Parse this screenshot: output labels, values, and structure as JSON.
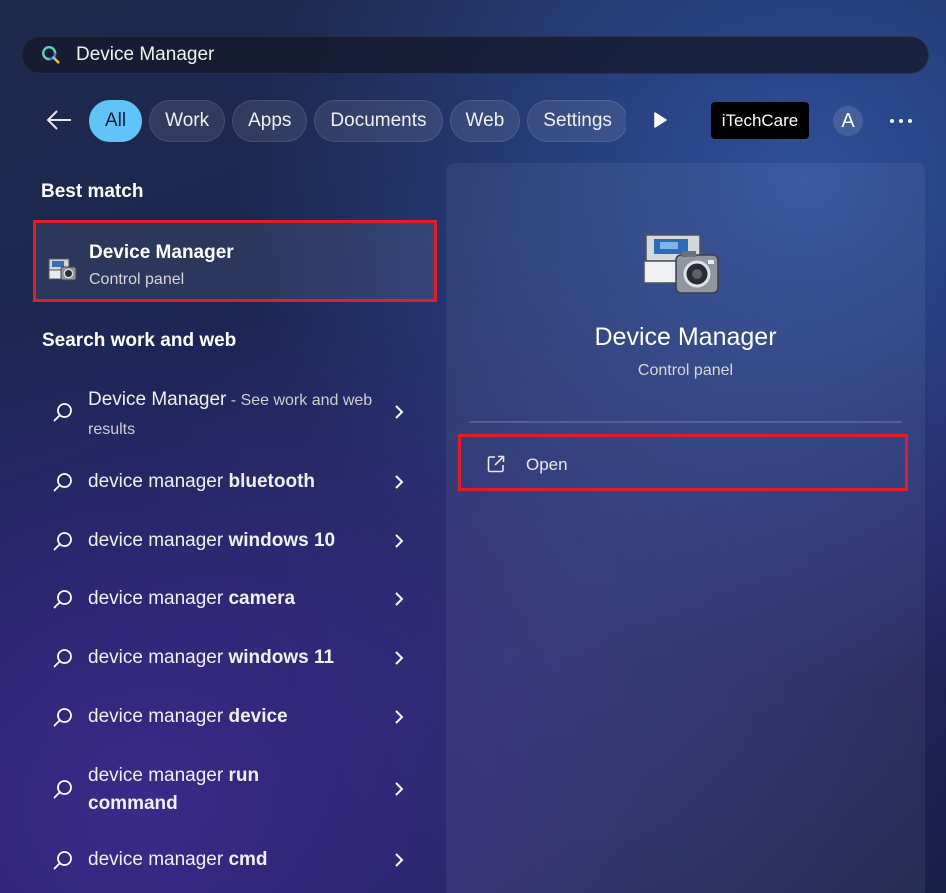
{
  "search": {
    "query": "Device Manager"
  },
  "filters": {
    "chips": [
      {
        "label": "All",
        "active": true
      },
      {
        "label": "Work",
        "active": false
      },
      {
        "label": "Apps",
        "active": false
      },
      {
        "label": "Documents",
        "active": false
      },
      {
        "label": "Web",
        "active": false
      },
      {
        "label": "Settings",
        "active": false
      }
    ],
    "brand_label": "iTechCare",
    "avatar_initial": "A"
  },
  "best_match": {
    "heading": "Best match",
    "name": "Device Manager",
    "subtitle": "Control panel"
  },
  "web_section": {
    "heading": "Search work and web",
    "results": [
      {
        "prefix": "Device Manager",
        "bold": "",
        "hint": " - See work and web results"
      },
      {
        "prefix": "device manager ",
        "bold": "bluetooth",
        "hint": ""
      },
      {
        "prefix": "device manager ",
        "bold": "windows 10",
        "hint": ""
      },
      {
        "prefix": "device manager ",
        "bold": "camera",
        "hint": ""
      },
      {
        "prefix": "device manager ",
        "bold": "windows 11",
        "hint": ""
      },
      {
        "prefix": "device manager ",
        "bold": "device",
        "hint": ""
      },
      {
        "prefix": "device manager ",
        "bold": "run command",
        "hint": ""
      },
      {
        "prefix": "device manager ",
        "bold": "cmd",
        "hint": ""
      }
    ]
  },
  "detail": {
    "name": "Device Manager",
    "subtitle": "Control panel",
    "actions": [
      {
        "label": "Open"
      }
    ]
  },
  "colors": {
    "accent": "#60c4f8",
    "highlight_border": "#e11d2a"
  },
  "icons": [
    "search-icon",
    "back-arrow-icon",
    "play-icon",
    "more-icon",
    "device-manager-icon",
    "magnifier-icon",
    "chevron-right-icon",
    "open-external-icon"
  ]
}
